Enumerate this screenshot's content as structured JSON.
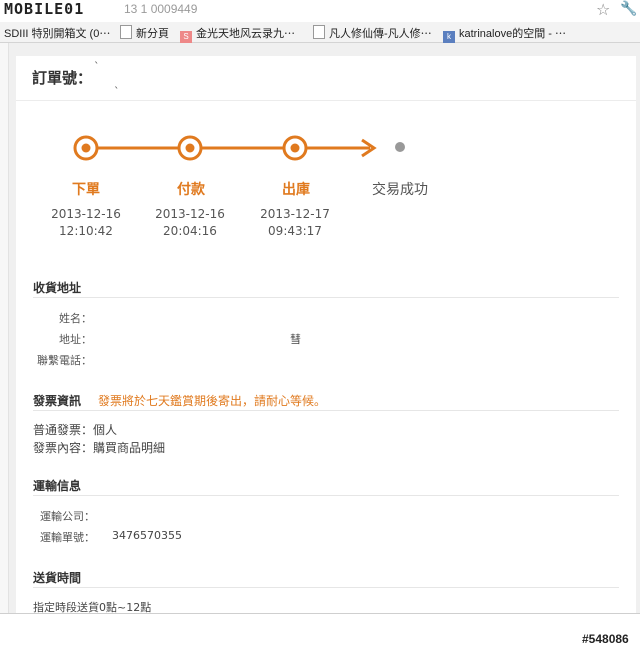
{
  "browser": {
    "logo": "MOBILE01",
    "url_text": "13 1 0009449",
    "bookmarks": [
      {
        "label": "SDIII 特別開箱文 (0⋯"
      },
      {
        "label": "新分頁"
      },
      {
        "label": "金光天地风云录九⋯"
      },
      {
        "label": "凡人修仙傳-凡人修⋯"
      },
      {
        "label": "katrinalove的空間 - ⋯"
      }
    ]
  },
  "order": {
    "label": "訂單號："
  },
  "progress": {
    "accent_color": "#e07a1f",
    "steps": [
      {
        "label": "下單",
        "date": "2013-12-16",
        "time": "12:10:42"
      },
      {
        "label": "付款",
        "date": "2013-12-16",
        "time": "20:04:16"
      },
      {
        "label": "出庫",
        "date": "2013-12-17",
        "time": "09:43:17"
      },
      {
        "label": "交易成功"
      }
    ]
  },
  "shipping_address": {
    "title": "收貨地址",
    "fields": [
      {
        "label": "姓名："
      },
      {
        "label": "地址："
      },
      {
        "label": "聯繫電話："
      }
    ],
    "address_fragment": "彗"
  },
  "invoice": {
    "title": "發票資訊",
    "notice": "發票將於七天鑑賞期後寄出，請耐心等候。",
    "lines": [
      "普通發票：個人",
      "發票內容：購買商品明細"
    ]
  },
  "transport": {
    "title": "運輸信息",
    "company_label": "運輸公司：",
    "tracking_label": "運輸單號：",
    "tracking_number": "3476570355"
  },
  "delivery_time": {
    "title": "送貨時間",
    "value": "指定時段送貨0點~12點"
  },
  "watermark": "#548086"
}
